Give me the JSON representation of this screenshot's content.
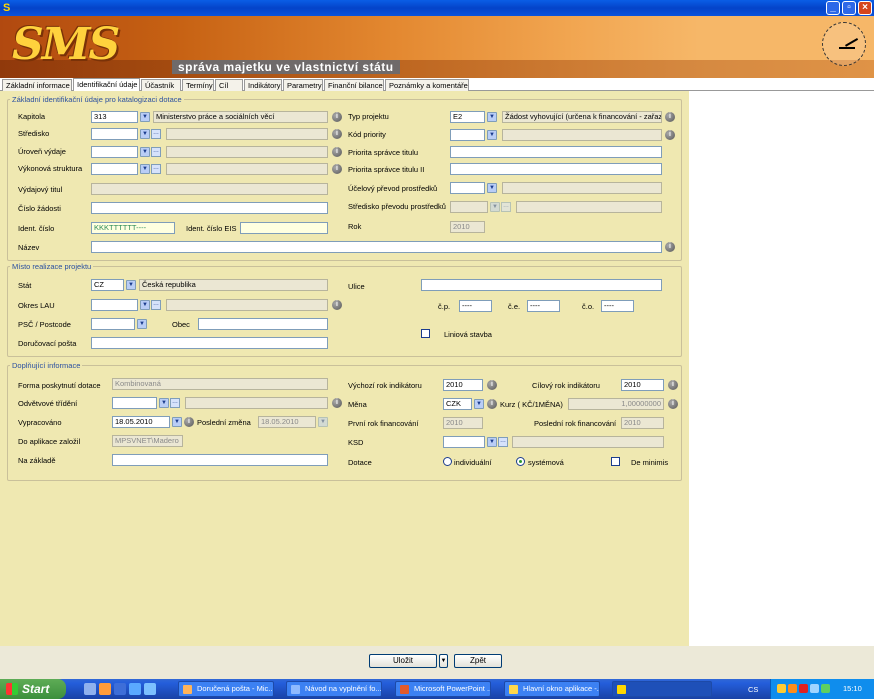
{
  "window": {
    "min": "_",
    "max": "▫",
    "close": "×"
  },
  "banner": {
    "logo": "SMS",
    "subtitle": "správa majetku ve vlastnictví státu"
  },
  "tabs": [
    "Základní informace",
    "Identifikační údaje",
    "Účastník",
    "Termíny",
    "Cíl",
    "Indikátory",
    "Parametry",
    "Finanční bilance",
    "Poznámky a komentáře"
  ],
  "sec1": {
    "legend": "Základní identifikační údaje pro katalogizaci dotace",
    "kapitola_label": "Kapitola",
    "kapitola_code": "313",
    "kapitola_name": "Ministerstvo práce a sociálních věcí",
    "stredisko_label": "Středisko",
    "uroven_label": "Úroveň výdaje",
    "vykonova_label": "Výkonová struktura",
    "vydajovy_label": "Výdajový titul",
    "cislo_zadosti_label": "Číslo žádosti",
    "ident_label": "Ident. číslo",
    "ident_value": "KKKTTTTTT----",
    "ident_eis_label": "Ident. číslo EIS",
    "nazev_label": "Název",
    "typ_label": "Typ projektu",
    "typ_code": "E2",
    "typ_name": "Žádost vyhovující (určena k financování - zařaz",
    "kod_label": "Kód priority",
    "priorita_label": "Priorita správce titulu",
    "priorita2_label": "Priorita správce titulu II",
    "ucelovy_label": "Účelový převod prostředků",
    "stredisko_prevodu_label": "Středisko převodu prostředků",
    "rok_label": "Rok",
    "rok_value": "2010"
  },
  "sec2": {
    "legend": "Místo realizace projektu",
    "stat_label": "Stát",
    "stat_code": "CZ",
    "stat_name": "Česká republika",
    "okres_label": "Okres LAU",
    "psc_label": "PSČ / Postcode",
    "obec_label": "Obec",
    "posta_label": "Doručovací pošta",
    "ulice_label": "Ulice",
    "cp_label": "č.p.",
    "ce_label": "č.e.",
    "co_label": "č.o.",
    "cp_value": "----",
    "ce_value": "----",
    "co_value": "----",
    "liniova_label": "Liniová stavba"
  },
  "sec3": {
    "legend": "Doplňující informace",
    "forma_label": "Forma poskytnutí dotace",
    "forma_value": "Kombinovaná",
    "odvetvove_label": "Odvětvové třídění",
    "vypracovano_label": "Vypracováno",
    "vypracovano_value": "18.05.2010",
    "posledni_label": "Poslední změna",
    "posledni_value": "18.05.2010",
    "zalozil_label": "Do aplikace založil",
    "zalozil_value": "MPSVNET\\Madero",
    "zaklad_label": "Na základě",
    "vychozi_label": "Výchozí rok indikátoru",
    "vychozi_value": "2010",
    "cilovy_label": "Cílový rok indikátoru",
    "cilovy_value": "2010",
    "mena_label": "Měna",
    "mena_value": "CZK",
    "kurz_label": "Kurz ( KČ/1MĚNA)",
    "kurz_value": "1,00000000",
    "prvni_label": "První rok financování",
    "prvni_value": "2010",
    "posledni_fin_label": "Poslední rok financování",
    "posledni_fin_value": "2010",
    "ksd_label": "KSD",
    "dotace_label": "Dotace",
    "individualni": "individuální",
    "systemova": "systémová",
    "deminimis": "De minimis"
  },
  "buttons": {
    "save": "Uložit",
    "back": "Zpět"
  },
  "taskbar": {
    "start": "Start",
    "tasks": [
      "Doručená pošta - Mic...",
      "Návod na vyplnění fo...",
      "Microsoft PowerPoint ...",
      "Hlavní okno aplikace -..."
    ],
    "lang": "CS",
    "clock": "15:10"
  }
}
